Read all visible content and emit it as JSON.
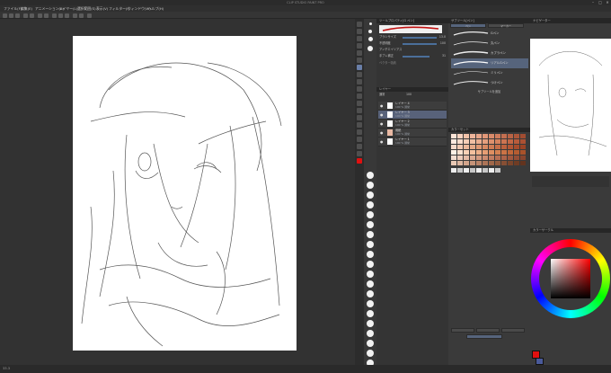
{
  "app": {
    "title": "CLIP STUDIO PAINT PRO"
  },
  "window_controls": [
    "–",
    "□",
    "✕"
  ],
  "menu": [
    "ファイル(F)",
    "編集(E)",
    "アニメーション(A)",
    "レイヤー(L)",
    "選択範囲(S)",
    "表示(V)",
    "フィルター(I)",
    "ウィンドウ(W)",
    "ヘルプ(H)"
  ],
  "tool_property": {
    "header": "ツールプロパティ[G ペン]",
    "rows": [
      {
        "label": "ブラシサイズ",
        "value": "13.0"
      },
      {
        "label": "不透明度",
        "value": "100"
      },
      {
        "label": "アンチエイリアス",
        "value": ""
      },
      {
        "label": "手ブレ補正",
        "value": "31"
      },
      {
        "label": "ベクター吸着",
        "value": ""
      }
    ]
  },
  "layers": {
    "header": "レイヤー",
    "blend": "通常",
    "opacity": "100",
    "items": [
      {
        "name": "レイヤー 4",
        "meta": "100 % 通常",
        "selected": false
      },
      {
        "name": "レイヤー 3",
        "meta": "100 % 通常",
        "selected": true
      },
      {
        "name": "レイヤー 2",
        "meta": "100 % 通常",
        "selected": false
      },
      {
        "name": "用紙",
        "meta": "100 % 通常",
        "selected": false
      },
      {
        "name": "レイヤー 1",
        "meta": "100 % 通常",
        "selected": false
      }
    ]
  },
  "brush_panel": {
    "header": "サブツール[ペン]",
    "tabs": [
      "ペン",
      "マーカー"
    ],
    "brushes": [
      "Gペン",
      "丸ペン",
      "カブラペン",
      "リアルGペン",
      "ミリペン",
      "つけペン"
    ],
    "footer": "サブツールを追加"
  },
  "color_set": {
    "header": "カラーセット"
  },
  "navigator": {
    "header": "ナビゲーター"
  },
  "color_wheel": {
    "header": "カラーサークル",
    "main_color": "#e01010",
    "sub_color": "#4a5a9a"
  },
  "statusbar": {
    "zoom": "33.3"
  }
}
